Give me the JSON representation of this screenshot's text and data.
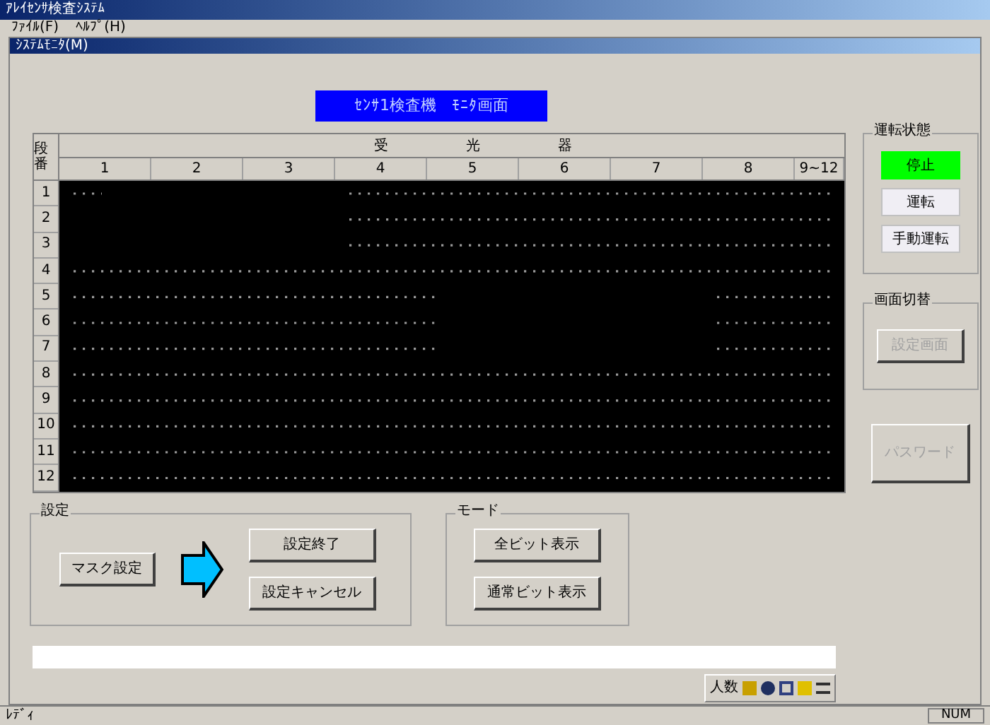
{
  "window": {
    "title": "ｱﾚｲｾﾝｻ検査ｼｽﾃﾑ"
  },
  "menu": [
    {
      "label": "ﾌｧｲﾙ(F)"
    },
    {
      "label": "ﾍﾙﾌﾟ(H)"
    }
  ],
  "child_window": {
    "title": "ｼｽﾃﾑﾓﾆﾀ(M)"
  },
  "banner": "ｾﾝｻ1検査機　ﾓﾆﾀ画面",
  "grid": {
    "row_header": "段番",
    "group_header": [
      "受",
      "光",
      "器"
    ],
    "columns": [
      "1",
      "2",
      "3",
      "4",
      "5",
      "6",
      "7",
      "8",
      "9~12"
    ],
    "rows": [
      "1",
      "2",
      "3",
      "4",
      "5",
      "6",
      "7",
      "8",
      "9",
      "10",
      "11",
      "12"
    ]
  },
  "run_state": {
    "title": "運転状態",
    "items": [
      {
        "label": "停止",
        "selected": true
      },
      {
        "label": "運転",
        "selected": false
      },
      {
        "label": "手動運転",
        "selected": false
      }
    ]
  },
  "screen_switch": {
    "title": "画面切替",
    "button": {
      "label": "設定画面",
      "disabled": true
    }
  },
  "password_button": {
    "label": "パスワード",
    "disabled": true
  },
  "settings": {
    "title": "設定",
    "mask_button": "マスク設定",
    "buttons": [
      "設定終了",
      "設定キャンセル"
    ]
  },
  "mode": {
    "title": "モード",
    "buttons": [
      "全ビット表示",
      "通常ビット表示"
    ]
  },
  "toolbar": {
    "label": "人数"
  },
  "status_bar": {
    "left": "ﾚﾃﾞｨ",
    "right": "NUM"
  }
}
